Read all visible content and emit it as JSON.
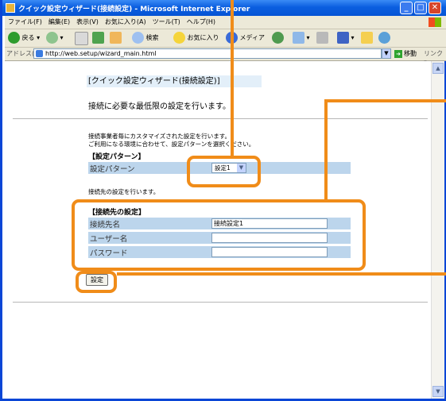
{
  "window": {
    "title": "クイック設定ウィザード(接続設定) - Microsoft Internet Explorer",
    "controls": {
      "minimize": "_",
      "maximize": "□",
      "close": "✕"
    }
  },
  "menubar": {
    "items": [
      "ファイル(F)",
      "編集(E)",
      "表示(V)",
      "お気に入り(A)",
      "ツール(T)",
      "ヘルプ(H)"
    ]
  },
  "toolbar": {
    "back": "戻る",
    "search": "検索",
    "favorites": "お気に入り",
    "media": "メディア"
  },
  "addressbar": {
    "label": "アドレス(D)",
    "url": "http://web.setup/wizard_main.html",
    "go": "移動",
    "links": "リンク »"
  },
  "page": {
    "title": "[クイック設定ウィザード(接続設定)]",
    "subtitle": "接続に必要な最低限の設定を行います。",
    "desc1": "接続事業者毎にカスタマイズされた設定を行います。",
    "desc2": "ご利用になる環境に合わせて、設定パターンを選択ください。",
    "pattern_section": "【設定パターン】",
    "pattern_label": "設定パターン",
    "pattern_value": "設定1",
    "conn_desc": "接続先の設定を行います。",
    "conn_section": "【接続先の設定】",
    "fields": [
      {
        "label": "接続先名",
        "value": "接続設定1"
      },
      {
        "label": "ユーザー名",
        "value": ""
      },
      {
        "label": "パスワード",
        "value": ""
      }
    ],
    "submit": "設定"
  },
  "annotation_color": "#f08c19"
}
